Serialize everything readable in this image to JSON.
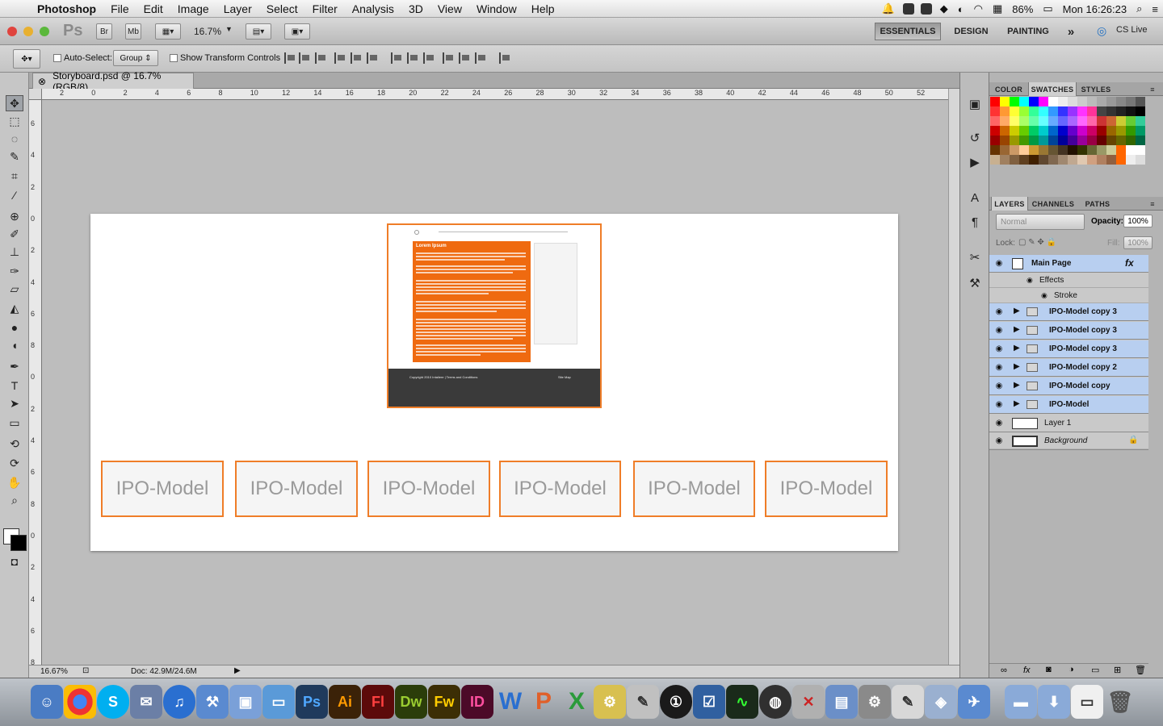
{
  "menubar": {
    "app": "Photoshop",
    "items": [
      "File",
      "Edit",
      "Image",
      "Layer",
      "Select",
      "Filter",
      "Analysis",
      "3D",
      "View",
      "Window",
      "Help"
    ],
    "battery": "86%",
    "clock": "Mon 16:26:23"
  },
  "appbar": {
    "ps_logo": "Ps",
    "bridge": "Br",
    "minibridge": "Mb",
    "zoom": "16.7%",
    "workspaces": [
      "ESSENTIALS",
      "DESIGN",
      "PAINTING"
    ],
    "more": "»",
    "cslive": "CS Live"
  },
  "options": {
    "auto_select_label": "Auto-Select:",
    "auto_select_value": "Group",
    "show_transform_label": "Show Transform Controls"
  },
  "document": {
    "tab_title": "Storyboard.psd @ 16.7% (RGB/8)",
    "zoom_status": "16.67%",
    "doc_size": "Doc: 42.9M/24.6M",
    "ruler_h": [
      "2",
      "0",
      "2",
      "4",
      "6",
      "8",
      "10",
      "12",
      "14",
      "16",
      "18",
      "20",
      "22",
      "24",
      "26",
      "28",
      "30",
      "32",
      "34",
      "36",
      "38",
      "40",
      "42",
      "44",
      "46",
      "48",
      "50",
      "52"
    ],
    "ruler_v": [
      "6",
      "4",
      "2",
      "0",
      "2",
      "4",
      "6",
      "8",
      "0",
      "2",
      "4",
      "6",
      "8",
      "0",
      "2",
      "4",
      "6",
      "8"
    ],
    "boxes": [
      "IPO-Model",
      "IPO-Model",
      "IPO-Model",
      "IPO-Model",
      "IPO-Model",
      "IPO-Model"
    ],
    "webpage": {
      "heading": "Lorem Ipsum",
      "footer_title": "Copyright 2010 Intaliere | Terms and Conditions",
      "sitemap": "Site Map"
    }
  },
  "panels": {
    "color_tabs": [
      "COLOR",
      "SWATCHES",
      "STYLES"
    ],
    "layer_tabs": [
      "LAYERS",
      "CHANNELS",
      "PATHS"
    ],
    "blend_mode": "Normal",
    "opacity_label": "Opacity:",
    "opacity_value": "100%",
    "lock_label": "Lock:",
    "fill_label": "Fill:",
    "fill_value": "100%",
    "layers": [
      {
        "name": "Main Page",
        "fx": "fx"
      },
      {
        "name": "Effects"
      },
      {
        "name": "Stroke"
      },
      {
        "name": "IPO-Model copy 3"
      },
      {
        "name": "IPO-Model copy 3"
      },
      {
        "name": "IPO-Model copy 3"
      },
      {
        "name": "IPO-Model copy 2"
      },
      {
        "name": "IPO-Model copy"
      },
      {
        "name": "IPO-Model"
      },
      {
        "name": "Layer 1"
      },
      {
        "name": "Background"
      }
    ]
  },
  "dock": {
    "apps": [
      "S",
      "Ps",
      "Ai",
      "Fl",
      "Dw",
      "Fw",
      "ID",
      "W"
    ]
  },
  "colors": {
    "accent_orange": "#ef7d28",
    "selection_blue": "#b8cff0"
  }
}
